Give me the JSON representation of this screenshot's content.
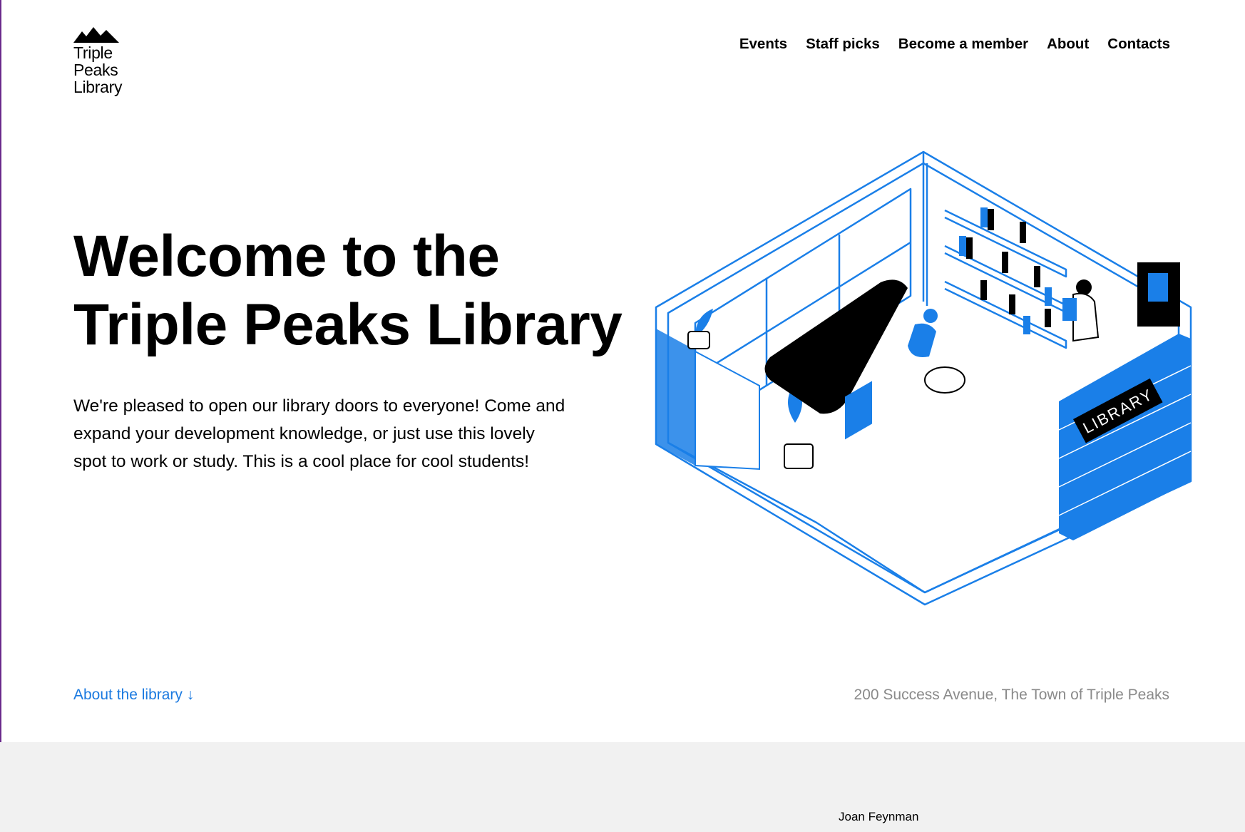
{
  "header": {
    "logo": {
      "lines": [
        "Triple",
        "Peaks",
        "Library"
      ],
      "icon": "mountain-peaks-icon"
    },
    "nav": [
      {
        "label": "Events"
      },
      {
        "label": "Staff picks"
      },
      {
        "label": "Become a member"
      },
      {
        "label": "About"
      },
      {
        "label": "Contacts"
      }
    ]
  },
  "hero": {
    "title_line1": "Welcome to the",
    "title_line2": "Triple Peaks Library",
    "text": "We're pleased to open our library doors to everyone! Come and expand your development knowledge, or just use this lovely spot to work or study. This is a cool place for cool students!",
    "illustration": {
      "sign_text": "LIBRARY",
      "icon": "isometric-library-room-illustration"
    }
  },
  "footer_bar": {
    "about_link": "About the library ↓",
    "address": "200 Success Avenue, The Town of Triple Peaks"
  },
  "next_section": {
    "name": "Joan Feynman"
  },
  "colors": {
    "accent": "#1b7ae0",
    "illustration_blue": "#1a7fe8",
    "muted": "#8a8a8a",
    "band": "#f1f1f1"
  }
}
